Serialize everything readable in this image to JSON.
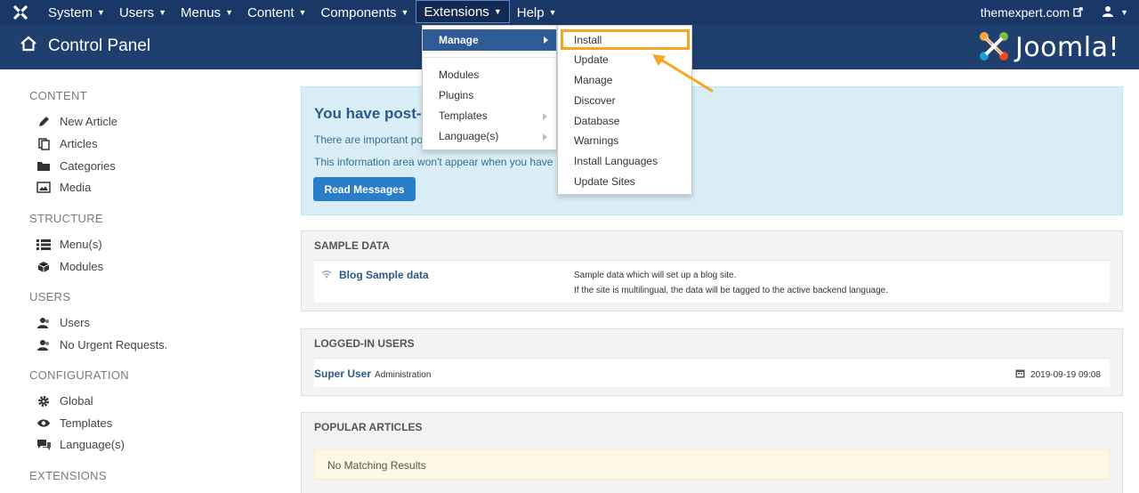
{
  "topnav": {
    "items": [
      {
        "label": "System"
      },
      {
        "label": "Users"
      },
      {
        "label": "Menus"
      },
      {
        "label": "Content"
      },
      {
        "label": "Components"
      },
      {
        "label": "Extensions"
      },
      {
        "label": "Help"
      }
    ],
    "site": "themexpert.com"
  },
  "header": {
    "title": "Control Panel",
    "brand": "Joomla!"
  },
  "sidebar": {
    "sections": [
      {
        "heading": "CONTENT",
        "items": [
          "New Article",
          "Articles",
          "Categories",
          "Media"
        ]
      },
      {
        "heading": "STRUCTURE",
        "items": [
          "Menu(s)",
          "Modules"
        ]
      },
      {
        "heading": "USERS",
        "items": [
          "Users",
          "No Urgent Requests."
        ]
      },
      {
        "heading": "CONFIGURATION",
        "items": [
          "Global",
          "Templates",
          "Language(s)"
        ]
      },
      {
        "heading": "EXTENSIONS",
        "items": []
      }
    ]
  },
  "alert": {
    "heading": "You have post-",
    "line1": "There are important po",
    "line2": "This information area won't appear when you have",
    "button": "Read Messages"
  },
  "sample_data": {
    "heading": "SAMPLE DATA",
    "link": "Blog Sample data",
    "desc1": "Sample data which will set up a blog site.",
    "desc2": "If the site is multilingual, the data will be tagged to the active backend language."
  },
  "logged_in": {
    "heading": "LOGGED-IN USERS",
    "user": "Super User",
    "role": "Administration",
    "datetime": "2019-09-19 09:08"
  },
  "popular": {
    "heading": "POPULAR ARTICLES",
    "empty": "No Matching Results"
  },
  "extensions_menu": {
    "manage": "Manage",
    "items": [
      "Modules",
      "Plugins",
      "Templates",
      "Language(s)"
    ]
  },
  "manage_submenu": {
    "items": [
      "Install",
      "Update",
      "Manage",
      "Discover",
      "Database",
      "Warnings",
      "Install Languages",
      "Update Sites"
    ]
  },
  "colors": {
    "nav": "#1a3867",
    "header": "#1f3f6f",
    "highlight": "#f5a623",
    "link": "#2a5a86"
  }
}
